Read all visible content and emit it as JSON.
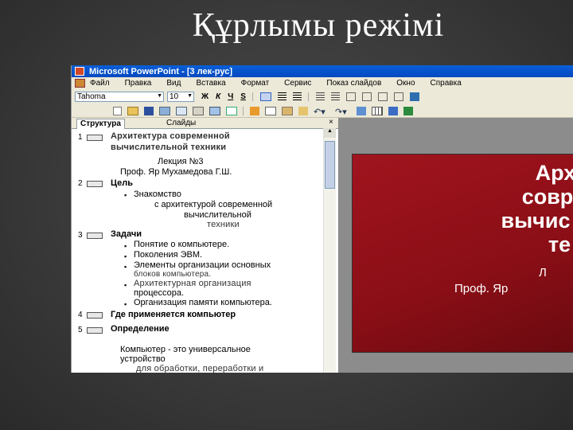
{
  "slide": {
    "title": "Құрлымы режімі"
  },
  "window": {
    "title": "Microsoft PowerPoint - [3 лек-рус]"
  },
  "menu": [
    "Файл",
    "Правка",
    "Вид",
    "Вставка",
    "Формат",
    "Сервис",
    "Показ слайдов",
    "Окно",
    "Справка"
  ],
  "toolbar": {
    "font_name": "Tahoma",
    "font_size": "10",
    "bold": "Ж",
    "italic": "К",
    "underline": "Ч",
    "shadow": "S"
  },
  "tabs": {
    "outline": "Структура",
    "slides": "Слайды",
    "close": "×"
  },
  "outline": {
    "s1_num": "1",
    "s1_title_a": "Архитектура современной",
    "s1_title_b": "вычислительной техники",
    "s1_line1": "Лекция №3",
    "s1_line2": "Проф. Яр Мухамедова Г.Ш.",
    "s2_num": "2",
    "s2_title": "Цель",
    "s2_b1": "Знакомство",
    "s2_b1b": "с архитектурой современной",
    "s2_b1c": "вычислительной",
    "s2_b1d": "техники",
    "s3_num": "3",
    "s3_title": "Задачи",
    "s3_b1": "Понятие о компьютере.",
    "s3_b2": "Поколения ЭВМ.",
    "s3_b3": "Элементы организации основных",
    "s3_b3b": "блоков компьютера.",
    "s3_b4": "Архитектурная организация",
    "s3_b4b": "процессора.",
    "s3_b5": "Организация памяти компьютера.",
    "s4_num": "4",
    "s4_title": "Где применяется компьютер",
    "s5_num": "5",
    "s5_title": "Определение",
    "s5_t1": "Компьютер - это универсальное",
    "s5_t2": "устройство",
    "s5_t3": "для обработки, переработки и"
  },
  "preview": {
    "t1": "Арх",
    "t2": "совр",
    "t3": "вычис",
    "t4": "те",
    "sub1": "Л",
    "sub2": "Проф. Яр"
  },
  "colors": {
    "slide_red": "#8a0e16",
    "title_bar_blue": "#0a5fd8",
    "background": "#3a3a3a"
  }
}
